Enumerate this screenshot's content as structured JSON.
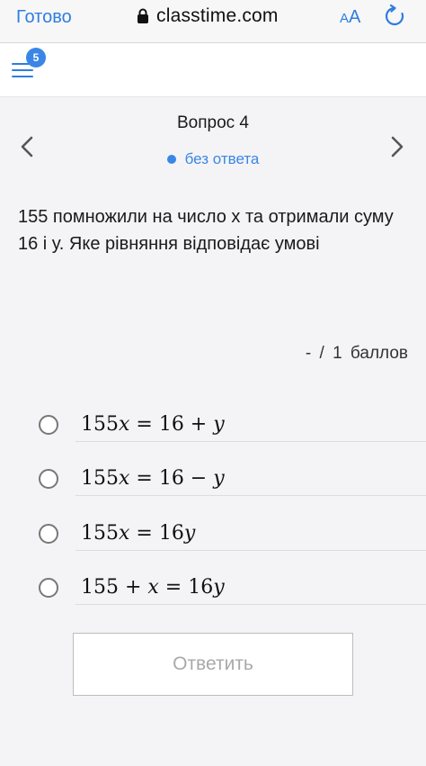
{
  "browser": {
    "done_label": "Готово",
    "url": "classtime.com",
    "text_size_label_small": "A",
    "text_size_label_large": "A"
  },
  "header": {
    "notification_count": "5"
  },
  "question": {
    "title": "Вопрос 4",
    "status": "без ответа",
    "text": "155 помножили на число х та отримали суму 16 і у. Яке рівняння відповідає умові",
    "points": "- / 1 баллов"
  },
  "options": [
    {
      "label": "155𝑥 = 16 + 𝑦"
    },
    {
      "label": "155𝑥 = 16 − 𝑦"
    },
    {
      "label": "155𝑥 = 16𝑦"
    },
    {
      "label": "155 + 𝑥 = 16𝑦"
    }
  ],
  "submit": {
    "label": "Ответить"
  },
  "colors": {
    "accent": "#3a86e6",
    "link": "#2f7de1",
    "background": "#f4f4f6"
  }
}
